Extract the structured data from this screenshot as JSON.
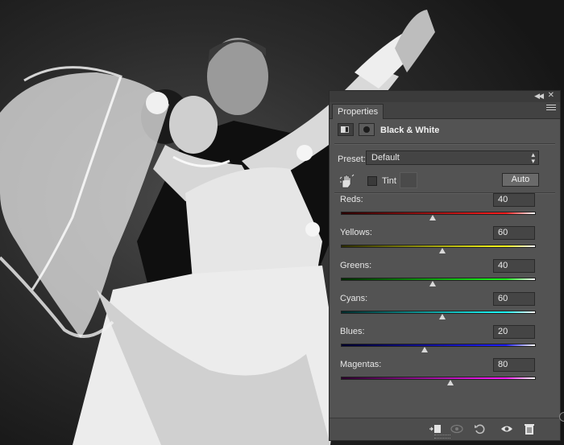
{
  "panel": {
    "collapse_icon": "double-chevron-icon",
    "close_icon": "close-icon",
    "tab_label": "Properties",
    "menu_icon": "panel-menu-icon",
    "adjustment_title": "Black & White",
    "preset_label": "Preset:",
    "preset_value": "Default",
    "tint_label": "Tint",
    "tint_checked": false,
    "auto_label": "Auto"
  },
  "sliders": [
    {
      "label": "Reds:",
      "value": "40",
      "fraction": 0.47,
      "colors": [
        "#2b0000",
        "#ff1e1e"
      ]
    },
    {
      "label": "Yellows:",
      "value": "60",
      "fraction": 0.52,
      "colors": [
        "#2b2b00",
        "#ffff1e"
      ]
    },
    {
      "label": "Greens:",
      "value": "40",
      "fraction": 0.47,
      "colors": [
        "#002b00",
        "#1eff1e"
      ]
    },
    {
      "label": "Cyans:",
      "value": "60",
      "fraction": 0.52,
      "colors": [
        "#002b2b",
        "#1effff"
      ]
    },
    {
      "label": "Blues:",
      "value": "20",
      "fraction": 0.43,
      "colors": [
        "#00002b",
        "#1e1eff"
      ]
    },
    {
      "label": "Magentas:",
      "value": "80",
      "fraction": 0.56,
      "colors": [
        "#2b002b",
        "#ff1eff"
      ]
    }
  ],
  "bottom_icons": [
    "clip-to-layer-icon",
    "view-previous-icon",
    "reset-icon",
    "visibility-eye-icon",
    "trash-icon"
  ]
}
